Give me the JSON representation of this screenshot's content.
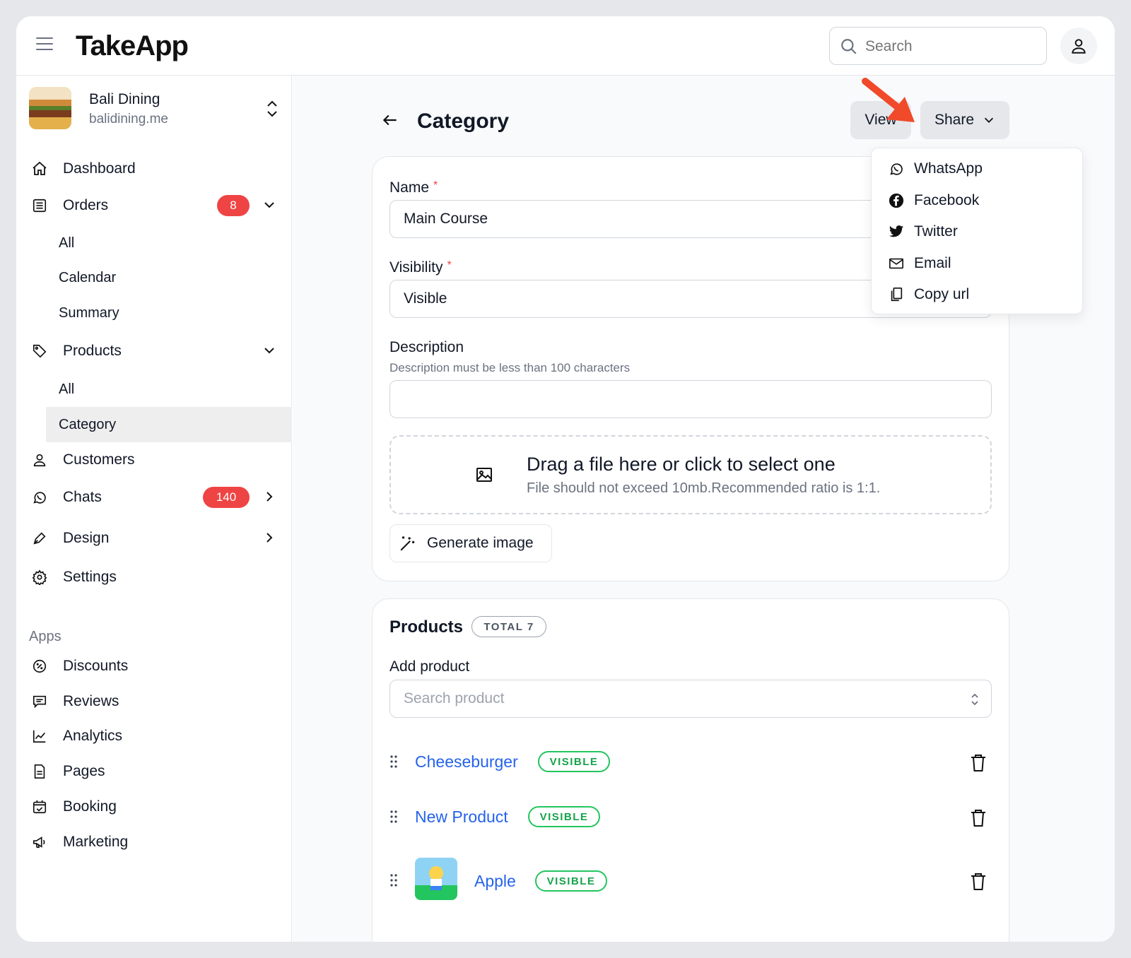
{
  "app": {
    "name": "TakeApp"
  },
  "search": {
    "placeholder": "Search"
  },
  "store": {
    "name": "Bali Dining",
    "domain": "balidining.me"
  },
  "sidebar": {
    "dashboard": "Dashboard",
    "orders": {
      "label": "Orders",
      "badge": "8"
    },
    "orders_sub": [
      "All",
      "Calendar",
      "Summary"
    ],
    "products": {
      "label": "Products"
    },
    "products_sub": [
      "All",
      "Category"
    ],
    "customers": "Customers",
    "chats": {
      "label": "Chats",
      "badge": "140"
    },
    "design": "Design",
    "settings": "Settings",
    "apps_heading": "Apps",
    "apps": [
      "Discounts",
      "Reviews",
      "Analytics",
      "Pages",
      "Booking",
      "Marketing"
    ]
  },
  "page": {
    "title": "Category",
    "view_label": "View",
    "share_label": "Share"
  },
  "share_menu": [
    "WhatsApp",
    "Facebook",
    "Twitter",
    "Email",
    "Copy url"
  ],
  "form": {
    "name_label": "Name",
    "name_required": "*",
    "name_value": "Main Course",
    "visibility_label": "Visibility",
    "visibility_required": "*",
    "visibility_value": "Visible",
    "description_label": "Description",
    "description_hint": "Description must be less than 100 characters",
    "description_value": "",
    "dropzone_title": "Drag a file here or click to select one",
    "dropzone_hint": "File should not exceed 10mb.Recommended ratio is 1:1.",
    "generate_label": "Generate image"
  },
  "products_section": {
    "title": "Products",
    "total": "TOTAL 7",
    "add_label": "Add product",
    "search_placeholder": "Search product",
    "items": [
      {
        "name": "Cheeseburger",
        "status": "VISIBLE"
      },
      {
        "name": "New Product",
        "status": "VISIBLE"
      },
      {
        "name": "Apple",
        "status": "VISIBLE"
      }
    ]
  },
  "colors": {
    "accent_red": "#ef4444",
    "link_blue": "#2563eb",
    "visible_green": "#22c55e",
    "arrow": "#f04a2a"
  }
}
